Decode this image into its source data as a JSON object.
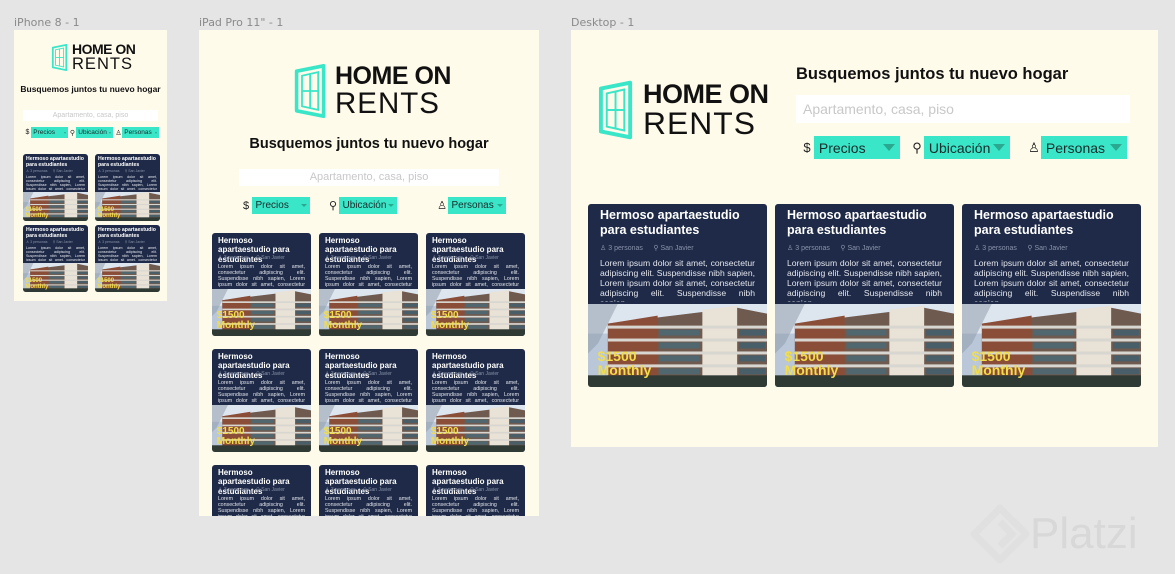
{
  "frames": {
    "iphone": "iPhone 8 - 1",
    "ipad": "iPad Pro 11\" - 1",
    "desktop": "Desktop - 1"
  },
  "logo": {
    "line1": "HOME ON",
    "line2": "RENTS",
    "icon": "window-icon",
    "color": "#3ae6c8"
  },
  "headline": "Busquemos juntos tu nuevo hogar",
  "search_placeholder": "Apartamento, casa, piso",
  "filters": [
    {
      "icon": "dollar-icon",
      "glyph": "$",
      "label": "Precios"
    },
    {
      "icon": "location-pin-icon",
      "glyph": "⚲",
      "label": "Ubicación"
    },
    {
      "icon": "people-icon",
      "glyph": "♙",
      "label": "Personas"
    }
  ],
  "card": {
    "title": "Hermoso apartaestudio para estudiantes",
    "people": "3 personas",
    "location": "San Javier",
    "description": "Lorem ipsum dolor sit amet, consectetur adipiscing elit. Suspendisse nibh sapien, Lorem ipsum dolor sit amet, consectetur adipiscing elit. Suspendisse nibh sapien...",
    "price": "$1500",
    "period": "Monthly"
  },
  "watermark": "Platzi",
  "colors": {
    "artboard": "#fffbeb",
    "card": "#1e2a47",
    "accent": "#3ae6c8",
    "price": "#f2dd4a"
  }
}
